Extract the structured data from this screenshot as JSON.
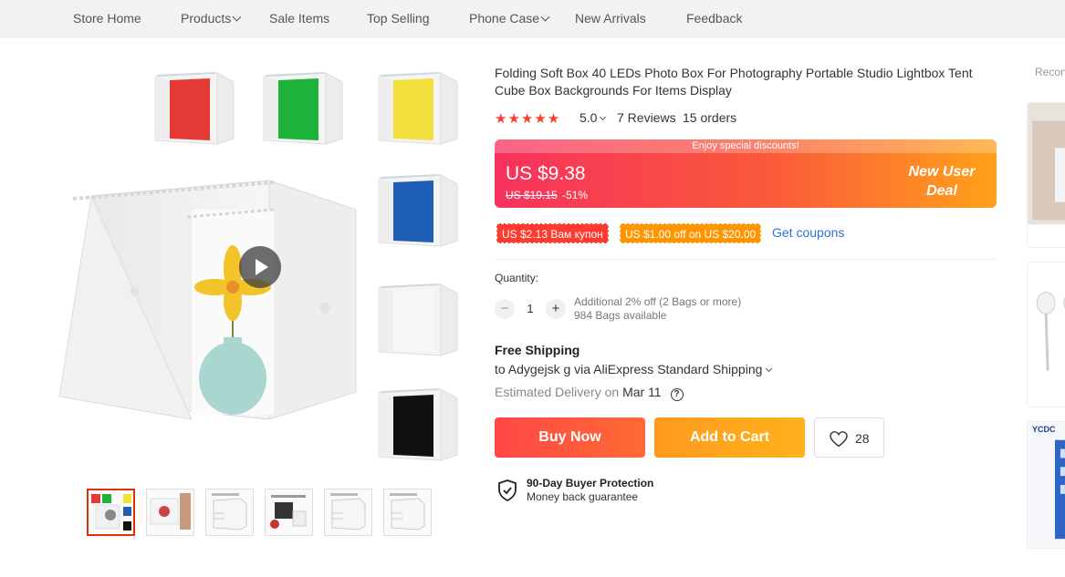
{
  "nav": {
    "items": [
      {
        "label": "Store Home",
        "has_dropdown": false
      },
      {
        "label": "Products",
        "has_dropdown": true
      },
      {
        "label": "Sale Items",
        "has_dropdown": false
      },
      {
        "label": "Top Selling",
        "has_dropdown": false
      },
      {
        "label": "Phone Case",
        "has_dropdown": true
      },
      {
        "label": "New Arrivals",
        "has_dropdown": false
      },
      {
        "label": "Feedback",
        "has_dropdown": false
      }
    ]
  },
  "gallery": {
    "side_thumbs": [
      {
        "color": "#e53935"
      },
      {
        "color": "#1db33a"
      },
      {
        "color": "#f2e13c"
      },
      {
        "color": "#1e5fb5"
      },
      {
        "color": "#f7f7f7"
      },
      {
        "color": "#111111"
      }
    ],
    "strip_count": 6,
    "selected_index": 0
  },
  "product": {
    "title": "Folding Soft Box 40 LEDs Photo Box For Photography Portable Studio Lightbox Tent Cube Box Backgrounds For Items Display",
    "stars": "★★★★★",
    "rating": "5.0",
    "reviews": "7 Reviews",
    "orders": "15 orders"
  },
  "price": {
    "banner": "Enjoy special discounts!",
    "current": "US $9.38",
    "original": "US $19.15",
    "discount": "-51%",
    "promo_line1": "New User",
    "promo_line2": "Deal"
  },
  "coupons": {
    "coupon1": "US $2.13 Вам купон",
    "coupon2": "US $1.00 off on US $20.00",
    "get_coupons": "Get coupons",
    "coupon1_color": "#ff3b30",
    "coupon2_color": "#ff9500"
  },
  "quantity": {
    "label": "Quantity:",
    "minus": "−",
    "plus": "+",
    "value": "1",
    "note1": "Additional 2% off (2 Bags or more)",
    "note2": "984 Bags available"
  },
  "shipping": {
    "title": "Free Shipping",
    "via": "to Adygejsk g via AliExpress Standard Shipping",
    "est_label": "Estimated Delivery on",
    "est_date": "Mar 11",
    "help": "?"
  },
  "actions": {
    "buy_now": "Buy Now",
    "add_to_cart": "Add to Cart",
    "wish_count": "28"
  },
  "protection": {
    "title": "90-Day Buyer Protection",
    "subtitle": "Money back guarantee"
  },
  "recommended": {
    "label": "Recon",
    "item3_brand": "YCDC"
  }
}
